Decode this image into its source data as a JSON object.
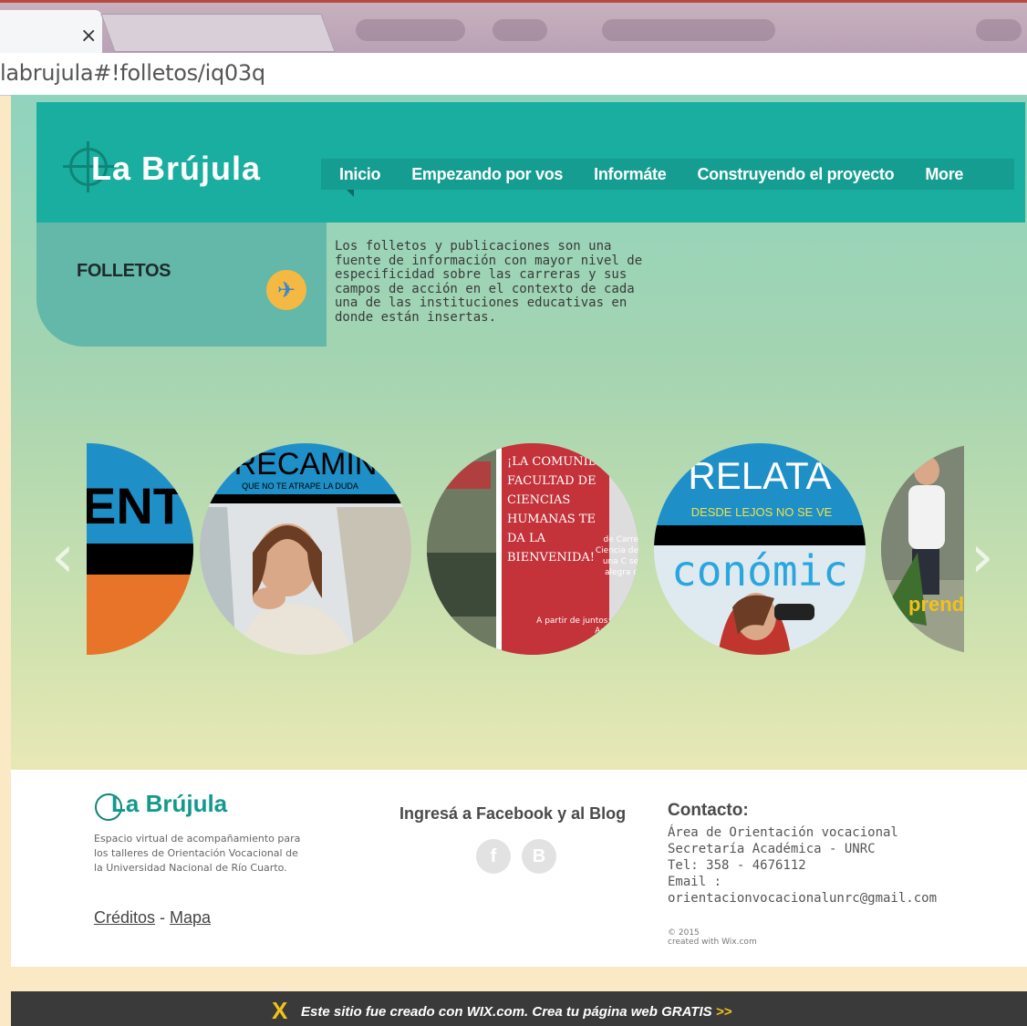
{
  "browser": {
    "tab_close": "×",
    "url": "labrujula#!folletos/iq03q"
  },
  "header": {
    "logo": "La Brújula",
    "nav": [
      "Inicio",
      "Empezando por vos",
      "Informáte",
      "Construyendo el proyecto",
      "More"
    ]
  },
  "section": {
    "title": "FOLLETOS",
    "description": "Los folletos y publicaciones son una\nfuente de información con mayor nivel de\nespecificidad sobre las carreras y sus\ncampos de acción en el contexto de cada\nuna de las instituciones educativas en\ndonde están insertas."
  },
  "gallery": {
    "prev": "‹",
    "next": "›",
    "items": [
      {
        "text": "ENT"
      },
      {
        "title": "RECAMIN",
        "subtitle": "QUE NO TE ATRAPE LA DUDA"
      },
      {
        "poster": "¡LA COMUNIDA FACULTAD DE CIENCIAS HUMANAS TE DA LA BIENVENIDA!",
        "side_text": "de Carre Ciencia de una C se alegra d",
        "bottom_text": "A partir de juntos: Vos Adminis"
      },
      {
        "title": "RELATA",
        "subtitle": "DESDE LEJOS NO SE VE",
        "text": "conómic"
      },
      {
        "text": "prend iante"
      }
    ],
    "colors": {
      "teal": "#0f8577",
      "red": "#c4323a",
      "orange": "#e8742a",
      "blue": "#1f8fc7"
    }
  },
  "footer": {
    "logo": "La Brújula",
    "tagline": "Espacio virtual de acompañamiento para\nlos talleres de Orientación Vocacional de\nla Universidad Nacional de Río Cuarto.",
    "credits": "Créditos",
    "separator": " - ",
    "map": "Mapa",
    "social_title": "Ingresá a Facebook y al Blog",
    "facebook_icon": "f",
    "blogger_icon": "B",
    "contact_title": "Contacto:",
    "contact": "Área de Orientación vocacional\nSecretaría Académica - UNRC\nTel: 358 - 4676112\nEmail :\norientacionvocacionalunrc@gmail.com",
    "copyright": "© 2015\ncreated with Wix.com"
  },
  "wix": {
    "logo": "X",
    "text": "Este sitio fue creado con WIX.com. Crea tu página web GRATIS ",
    "arrow": ">>"
  }
}
